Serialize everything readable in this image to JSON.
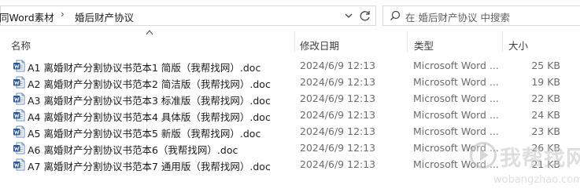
{
  "address_bar": {
    "crumbs": [
      "同Word素材",
      "婚后财产协议"
    ]
  },
  "search": {
    "placeholder": "在 婚后财产协议 中搜索"
  },
  "columns": {
    "name": "名称",
    "date": "修改日期",
    "type": "类型",
    "size": "大小"
  },
  "files": [
    {
      "name": "A1 离婚财产分割协议书范本1 简版（我帮找网）.doc",
      "date": "2024/6/9 12:13",
      "type": "Microsoft Word ...",
      "size": "25 KB"
    },
    {
      "name": "A2 离婚财产分割协议书范本2 简洁版（我帮找网）.doc",
      "date": "2024/6/9 12:13",
      "type": "Microsoft Word ...",
      "size": "19 KB"
    },
    {
      "name": "A3 离婚财产分割协议书范本3 标准版（我帮找网）.doc",
      "date": "2024/6/9 12:13",
      "type": "Microsoft Word ...",
      "size": "22 KB"
    },
    {
      "name": "A4 离婚财产分割协议书范本4 具体版（我帮找网）.doc",
      "date": "2024/6/9 12:13",
      "type": "Microsoft Word ...",
      "size": "24 KB"
    },
    {
      "name": "A5 离婚财产分割协议书范本5 新版（我帮找网）.doc",
      "date": "2024/6/9 12:13",
      "type": "Microsoft Word ...",
      "size": "23 KB"
    },
    {
      "name": "A6 离婚财产分割协议书范本6（我帮找网）.doc",
      "date": "2024/6/9 12:13",
      "type": "Microsoft Word ...",
      "size": "26 KB"
    },
    {
      "name": "A7 离婚财产分割协议书范本7 通用版（我帮找网）.doc",
      "date": "2024/6/9 12:13",
      "type": "Microsoft Word ...",
      "size": "21 KB"
    }
  ],
  "watermark": {
    "title": "我帮找网",
    "url": "wobangzhao.com"
  },
  "icons": {
    "file": "word-doc-icon",
    "search": "search-icon",
    "refresh": "refresh-icon",
    "dropdown": "chevron-down-icon",
    "sort": "sort-caret-icon"
  },
  "colors": {
    "word_blue": "#2b579a",
    "secondary_text": "#6b6b6b"
  }
}
